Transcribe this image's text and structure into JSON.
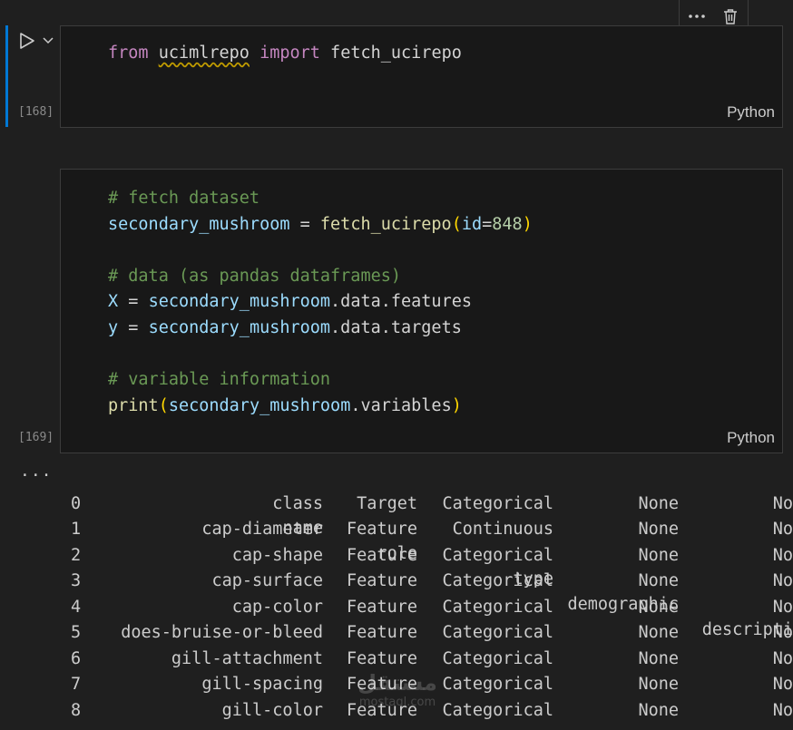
{
  "toolbar": {
    "more_icon": "ellipsis-icon",
    "delete_icon": "trash-icon"
  },
  "cells": [
    {
      "exec_count": "[168]",
      "language": "Python",
      "lines": [
        [
          {
            "t": "from",
            "c": "kw"
          },
          {
            "t": " ",
            "c": "op"
          },
          {
            "t": "ucimlrepo",
            "c": "mod"
          },
          {
            "t": " ",
            "c": "op"
          },
          {
            "t": "import",
            "c": "kw"
          },
          {
            "t": " fetch_ucirepo",
            "c": "op"
          }
        ]
      ]
    },
    {
      "exec_count": "[169]",
      "language": "Python",
      "lines": [
        [
          {
            "t": "# fetch dataset",
            "c": "cm"
          }
        ],
        [
          {
            "t": "secondary_mushroom",
            "c": "var"
          },
          {
            "t": " = ",
            "c": "op"
          },
          {
            "t": "fetch_ucirepo",
            "c": "fn"
          },
          {
            "t": "(",
            "c": "br"
          },
          {
            "t": "id",
            "c": "var"
          },
          {
            "t": "=",
            "c": "op"
          },
          {
            "t": "848",
            "c": "num"
          },
          {
            "t": ")",
            "c": "br"
          }
        ],
        [],
        [
          {
            "t": "# data (as pandas dataframes)",
            "c": "cm"
          }
        ],
        [
          {
            "t": "X",
            "c": "var"
          },
          {
            "t": " = ",
            "c": "op"
          },
          {
            "t": "secondary_mushroom",
            "c": "var"
          },
          {
            "t": ".data.features",
            "c": "op"
          }
        ],
        [
          {
            "t": "y",
            "c": "var"
          },
          {
            "t": " = ",
            "c": "op"
          },
          {
            "t": "secondary_mushroom",
            "c": "var"
          },
          {
            "t": ".data.targets",
            "c": "op"
          }
        ],
        [],
        [
          {
            "t": "# variable information",
            "c": "cm"
          }
        ],
        [
          {
            "t": "print",
            "c": "fn"
          },
          {
            "t": "(",
            "c": "br"
          },
          {
            "t": "secondary_mushroom",
            "c": "var"
          },
          {
            "t": ".variables",
            "c": "op"
          },
          {
            "t": ")",
            "c": "br"
          }
        ]
      ]
    }
  ],
  "output": {
    "dots": "···",
    "headers": {
      "idx": "",
      "name": "name",
      "role": "role",
      "type": "type",
      "demo": "demographic",
      "desc": "descripti"
    },
    "rows": [
      {
        "idx": "0",
        "name": "class",
        "role": "Target",
        "type": "Categorical",
        "demo": "None",
        "desc": "No"
      },
      {
        "idx": "1",
        "name": "cap-diameter",
        "role": "Feature",
        "type": "Continuous",
        "demo": "None",
        "desc": "No"
      },
      {
        "idx": "2",
        "name": "cap-shape",
        "role": "Feature",
        "type": "Categorical",
        "demo": "None",
        "desc": "No"
      },
      {
        "idx": "3",
        "name": "cap-surface",
        "role": "Feature",
        "type": "Categorical",
        "demo": "None",
        "desc": "No"
      },
      {
        "idx": "4",
        "name": "cap-color",
        "role": "Feature",
        "type": "Categorical",
        "demo": "None",
        "desc": "No"
      },
      {
        "idx": "5",
        "name": "does-bruise-or-bleed",
        "role": "Feature",
        "type": "Categorical",
        "demo": "None",
        "desc": "No"
      },
      {
        "idx": "6",
        "name": "gill-attachment",
        "role": "Feature",
        "type": "Categorical",
        "demo": "None",
        "desc": "No"
      },
      {
        "idx": "7",
        "name": "gill-spacing",
        "role": "Feature",
        "type": "Categorical",
        "demo": "None",
        "desc": "No"
      },
      {
        "idx": "8",
        "name": "gill-color",
        "role": "Feature",
        "type": "Categorical",
        "demo": "None",
        "desc": "No"
      }
    ]
  },
  "watermark": {
    "main": "مستقل",
    "sub": "mostaql.com"
  }
}
